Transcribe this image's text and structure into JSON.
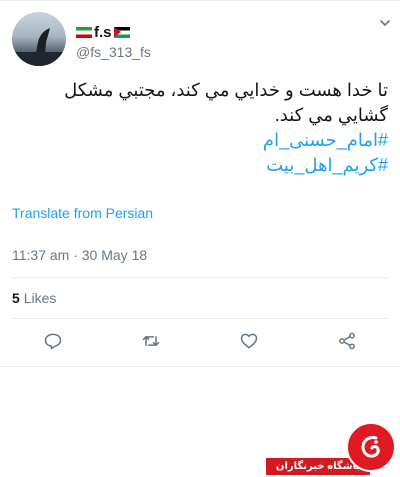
{
  "user": {
    "display_name": "f.s",
    "handle": "@fs_313_fs"
  },
  "tweet": {
    "lines": [
      "تا خدا هست و خدايي مي كند، مجتبي مشكل",
      "گشايي مي كند."
    ],
    "hashtags": [
      "#امام_حسنی_ام",
      "#کریم_اهل_بیت"
    ],
    "translate_label": "Translate from Persian",
    "timestamp": "11:37 am · 30 May 18"
  },
  "stats": {
    "likes_count": "5",
    "likes_label": "Likes"
  },
  "icons": {
    "reply": "reply-icon",
    "retweet": "retweet-icon",
    "like": "heart-icon",
    "share": "share-icon",
    "more": "chevron-down-icon"
  },
  "watermark": {
    "text": "باشگاه خبرنگاران"
  },
  "colors": {
    "link": "#1da1f2",
    "secondary": "#657786",
    "watermark_red": "#d31a21"
  }
}
